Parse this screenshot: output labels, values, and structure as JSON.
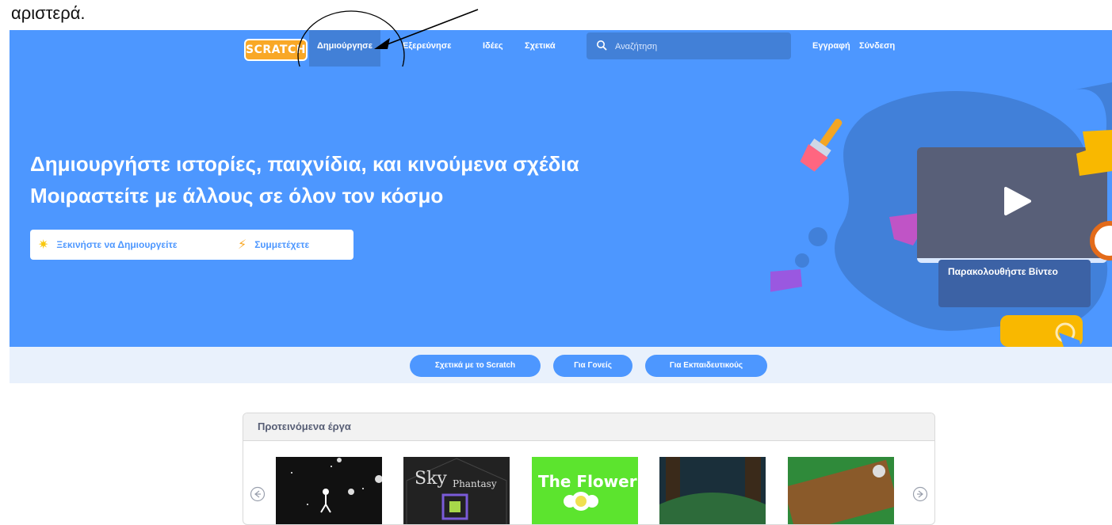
{
  "caption": "αριστερά.",
  "nav": {
    "logo": "SCRATCH",
    "links": [
      "Δημιούργησε",
      "Εξερεύνησε",
      "Ιδέες",
      "Σχετικά"
    ],
    "search_placeholder": "Αναζήτηση",
    "join": "Εγγραφή",
    "signin": "Σύνδεση"
  },
  "hero": {
    "title_line1": "Δημιουργήστε ιστορίες, παιχνίδια, και κινούμενα σχέδια",
    "title_line2": "Μοιραστείτε με άλλους σε όλον τον κόσμο",
    "start_button": "Ξεκινήστε να Δημιουργείτε",
    "join_button": "Συμμετέχετε",
    "watch_video": "Παρακολουθήστε Βίντεο"
  },
  "info_links": [
    "Σχετικά με το Scratch",
    "Για Γονείς",
    "Για Εκπαιδευτικούς"
  ],
  "featured": {
    "title": "Προτεινόμενα έργα",
    "thumbs": [
      "Sky",
      "Phantasy",
      "The Flower"
    ]
  },
  "colors": {
    "brand_blue": "#4d97ff",
    "nav_active": "#4280d7",
    "scratch_orange": "#f9a826"
  }
}
